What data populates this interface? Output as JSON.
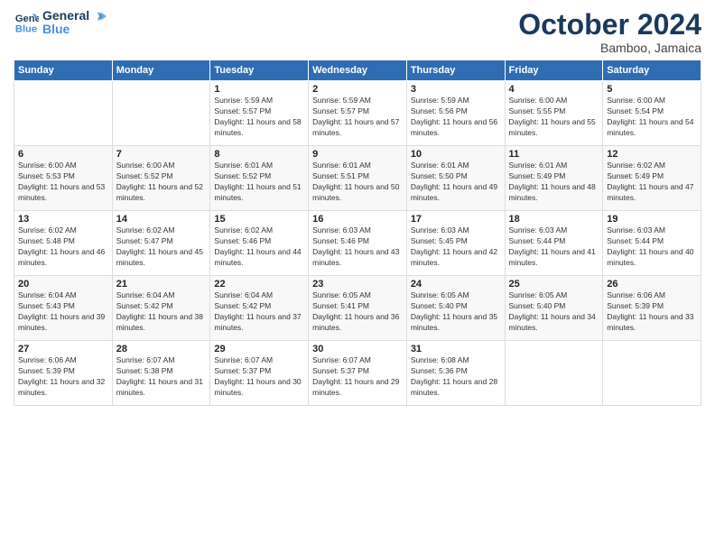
{
  "logo": {
    "line1": "General",
    "line2": "Blue"
  },
  "title": "October 2024",
  "subtitle": "Bamboo, Jamaica",
  "weekdays": [
    "Sunday",
    "Monday",
    "Tuesday",
    "Wednesday",
    "Thursday",
    "Friday",
    "Saturday"
  ],
  "weeks": [
    [
      {
        "day": "",
        "detail": ""
      },
      {
        "day": "",
        "detail": ""
      },
      {
        "day": "1",
        "detail": "Sunrise: 5:59 AM\nSunset: 5:57 PM\nDaylight: 11 hours and 58 minutes."
      },
      {
        "day": "2",
        "detail": "Sunrise: 5:59 AM\nSunset: 5:57 PM\nDaylight: 11 hours and 57 minutes."
      },
      {
        "day": "3",
        "detail": "Sunrise: 5:59 AM\nSunset: 5:56 PM\nDaylight: 11 hours and 56 minutes."
      },
      {
        "day": "4",
        "detail": "Sunrise: 6:00 AM\nSunset: 5:55 PM\nDaylight: 11 hours and 55 minutes."
      },
      {
        "day": "5",
        "detail": "Sunrise: 6:00 AM\nSunset: 5:54 PM\nDaylight: 11 hours and 54 minutes."
      }
    ],
    [
      {
        "day": "6",
        "detail": "Sunrise: 6:00 AM\nSunset: 5:53 PM\nDaylight: 11 hours and 53 minutes."
      },
      {
        "day": "7",
        "detail": "Sunrise: 6:00 AM\nSunset: 5:52 PM\nDaylight: 11 hours and 52 minutes."
      },
      {
        "day": "8",
        "detail": "Sunrise: 6:01 AM\nSunset: 5:52 PM\nDaylight: 11 hours and 51 minutes."
      },
      {
        "day": "9",
        "detail": "Sunrise: 6:01 AM\nSunset: 5:51 PM\nDaylight: 11 hours and 50 minutes."
      },
      {
        "day": "10",
        "detail": "Sunrise: 6:01 AM\nSunset: 5:50 PM\nDaylight: 11 hours and 49 minutes."
      },
      {
        "day": "11",
        "detail": "Sunrise: 6:01 AM\nSunset: 5:49 PM\nDaylight: 11 hours and 48 minutes."
      },
      {
        "day": "12",
        "detail": "Sunrise: 6:02 AM\nSunset: 5:49 PM\nDaylight: 11 hours and 47 minutes."
      }
    ],
    [
      {
        "day": "13",
        "detail": "Sunrise: 6:02 AM\nSunset: 5:48 PM\nDaylight: 11 hours and 46 minutes."
      },
      {
        "day": "14",
        "detail": "Sunrise: 6:02 AM\nSunset: 5:47 PM\nDaylight: 11 hours and 45 minutes."
      },
      {
        "day": "15",
        "detail": "Sunrise: 6:02 AM\nSunset: 5:46 PM\nDaylight: 11 hours and 44 minutes."
      },
      {
        "day": "16",
        "detail": "Sunrise: 6:03 AM\nSunset: 5:46 PM\nDaylight: 11 hours and 43 minutes."
      },
      {
        "day": "17",
        "detail": "Sunrise: 6:03 AM\nSunset: 5:45 PM\nDaylight: 11 hours and 42 minutes."
      },
      {
        "day": "18",
        "detail": "Sunrise: 6:03 AM\nSunset: 5:44 PM\nDaylight: 11 hours and 41 minutes."
      },
      {
        "day": "19",
        "detail": "Sunrise: 6:03 AM\nSunset: 5:44 PM\nDaylight: 11 hours and 40 minutes."
      }
    ],
    [
      {
        "day": "20",
        "detail": "Sunrise: 6:04 AM\nSunset: 5:43 PM\nDaylight: 11 hours and 39 minutes."
      },
      {
        "day": "21",
        "detail": "Sunrise: 6:04 AM\nSunset: 5:42 PM\nDaylight: 11 hours and 38 minutes."
      },
      {
        "day": "22",
        "detail": "Sunrise: 6:04 AM\nSunset: 5:42 PM\nDaylight: 11 hours and 37 minutes."
      },
      {
        "day": "23",
        "detail": "Sunrise: 6:05 AM\nSunset: 5:41 PM\nDaylight: 11 hours and 36 minutes."
      },
      {
        "day": "24",
        "detail": "Sunrise: 6:05 AM\nSunset: 5:40 PM\nDaylight: 11 hours and 35 minutes."
      },
      {
        "day": "25",
        "detail": "Sunrise: 6:05 AM\nSunset: 5:40 PM\nDaylight: 11 hours and 34 minutes."
      },
      {
        "day": "26",
        "detail": "Sunrise: 6:06 AM\nSunset: 5:39 PM\nDaylight: 11 hours and 33 minutes."
      }
    ],
    [
      {
        "day": "27",
        "detail": "Sunrise: 6:06 AM\nSunset: 5:39 PM\nDaylight: 11 hours and 32 minutes."
      },
      {
        "day": "28",
        "detail": "Sunrise: 6:07 AM\nSunset: 5:38 PM\nDaylight: 11 hours and 31 minutes."
      },
      {
        "day": "29",
        "detail": "Sunrise: 6:07 AM\nSunset: 5:37 PM\nDaylight: 11 hours and 30 minutes."
      },
      {
        "day": "30",
        "detail": "Sunrise: 6:07 AM\nSunset: 5:37 PM\nDaylight: 11 hours and 29 minutes."
      },
      {
        "day": "31",
        "detail": "Sunrise: 6:08 AM\nSunset: 5:36 PM\nDaylight: 11 hours and 28 minutes."
      },
      {
        "day": "",
        "detail": ""
      },
      {
        "day": "",
        "detail": ""
      }
    ]
  ]
}
